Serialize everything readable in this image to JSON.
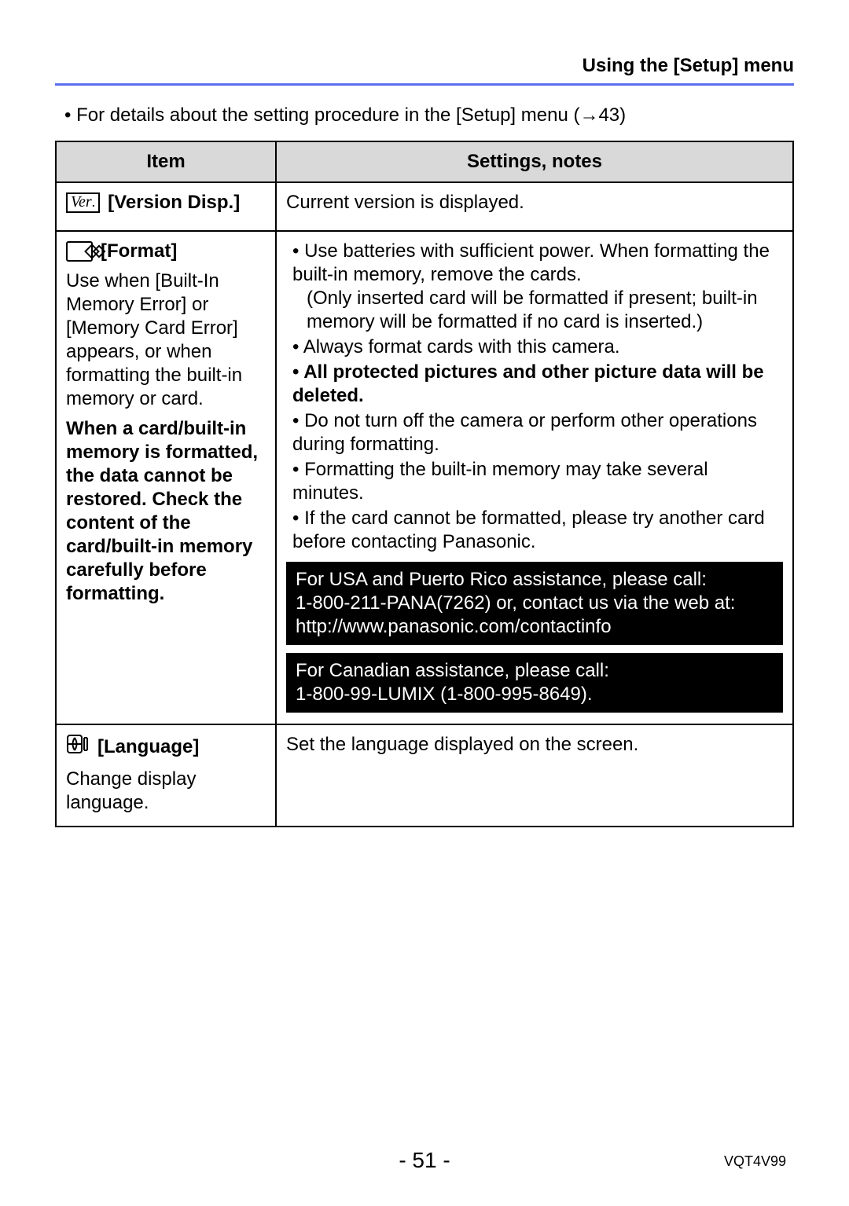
{
  "header": {
    "title": "Using the [Setup] menu"
  },
  "intro": {
    "bullet": "• ",
    "text": "For details about the setting procedure in the [Setup] menu (→43)"
  },
  "table": {
    "headers": {
      "item": "Item",
      "notes": "Settings, notes"
    },
    "rows": {
      "version": {
        "title": "[Version Disp.]",
        "notes_text": "Current version is displayed."
      },
      "format": {
        "title": "[Format]",
        "desc1": "Use when [Built-In Memory Error] or [Memory Card Error] appears, or when formatting the built-in memory or card.",
        "desc2_bold": "When a card/built-in memory is formatted, the data cannot be restored. Check the content of the card/built-in memory carefully before formatting.",
        "n1a": "Use batteries with sufficient power. When formatting the built-in memory, remove the cards.",
        "n1b": "(Only inserted card will be formatted if present; built-in memory will be formatted if no card is inserted.)",
        "n2": "Always format cards with this camera.",
        "n3_bold": "All protected pictures and other picture data will be deleted.",
        "n4": "Do not turn off the camera or perform other operations during formatting.",
        "n5": "Formatting the built-in memory may take several minutes.",
        "n6": "If the card cannot be formatted, please try another card before contacting Panasonic.",
        "callout_usa_l1": "For USA and Puerto Rico assistance, please call:",
        "callout_usa_l2": "1-800-211-PANA(7262) or, contact us via the web at:",
        "callout_usa_l3": "http://www.panasonic.com/contactinfo",
        "callout_ca_l1": "For Canadian assistance, please call:",
        "callout_ca_l2": "1-800-99-LUMIX (1-800-995-8649)."
      },
      "language": {
        "title": "[Language]",
        "desc": "Change display language.",
        "notes_text": "Set the language displayed on the screen."
      }
    }
  },
  "footer": {
    "page": "- 51 -",
    "doc_code": "VQT4V99"
  }
}
